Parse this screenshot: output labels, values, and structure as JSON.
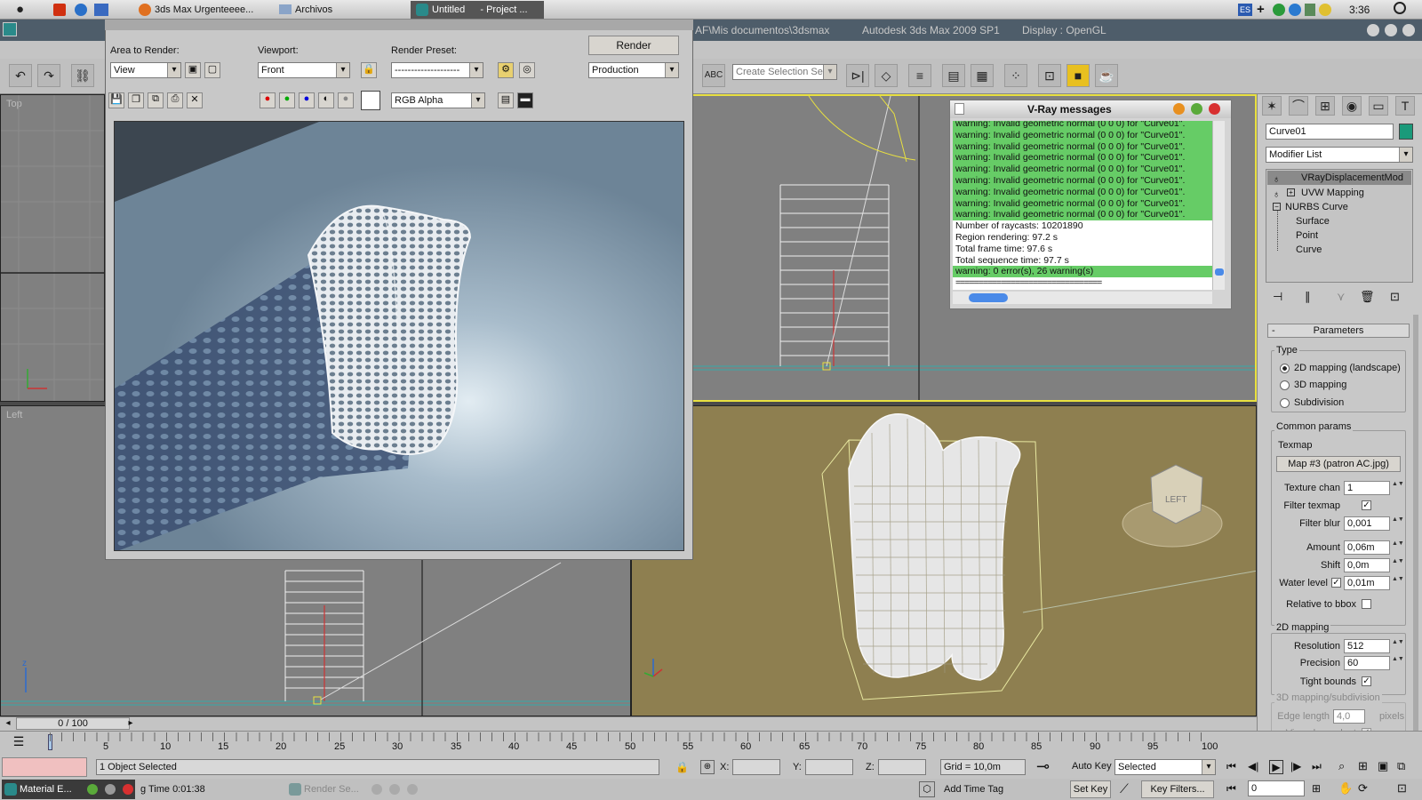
{
  "taskbar_top": {
    "tasks": [
      {
        "label": "3ds Max Urgenteeee..."
      },
      {
        "label": "Archivos"
      },
      {
        "label": "Untitled"
      },
      {
        "label": "- Project ..."
      }
    ],
    "tray_badge": "ES",
    "clock": "3:36"
  },
  "max": {
    "title_path": "AF\\Mis documentos\\3dsmax",
    "title_app": "Autodesk 3ds Max  2009 SP1",
    "title_display": "Display : OpenGL",
    "selection_set_placeholder": "Create Selection Set",
    "viewport_labels": {
      "top": "Top",
      "left": "Left"
    }
  },
  "render_window": {
    "area_label": "Area to Render:",
    "area_value": "View",
    "viewport_label": "Viewport:",
    "viewport_value": "Front",
    "preset_label": "Render Preset:",
    "preset_value": "--------------------",
    "render_button": "Render",
    "production_value": "Production",
    "channel_value": "RGB Alpha"
  },
  "vray": {
    "title": "V-Ray messages",
    "warnings": [
      "warning: Invalid geometric normal (0 0 0) for \"Curve01\".",
      "warning: Invalid geometric normal (0 0 0) for \"Curve01\".",
      "warning: Invalid geometric normal (0 0 0) for \"Curve01\".",
      "warning: Invalid geometric normal (0 0 0) for \"Curve01\".",
      "warning: Invalid geometric normal (0 0 0) for \"Curve01\".",
      "warning: Invalid geometric normal (0 0 0) for \"Curve01\".",
      "warning: Invalid geometric normal (0 0 0) for \"Curve01\".",
      "warning: Invalid geometric normal (0 0 0) for \"Curve01\".",
      "warning: Invalid geometric normal (0 0 0) for \"Curve01\"."
    ],
    "stats": [
      "Number of raycasts: 10201890",
      "Region rendering: 97.2 s",
      "Total frame time: 97.6 s",
      "Total sequence time: 97.7 s"
    ],
    "summary": "warning: 0 error(s), 26 warning(s)",
    "divider": "================================"
  },
  "command_panel": {
    "object_name": "Curve01",
    "object_color": "#1a9a7a",
    "modifier_list": "Modifier List",
    "stack": [
      {
        "label": "VRayDisplacementMod",
        "selected": true
      },
      {
        "label": "UVW Mapping",
        "selected": false
      },
      {
        "label": "NURBS Curve",
        "selected": false
      },
      {
        "label": "Surface",
        "selected": false
      },
      {
        "label": "Point",
        "selected": false
      },
      {
        "label": "Curve",
        "selected": false
      }
    ],
    "params": {
      "rollout": "Parameters",
      "type_group": "Type",
      "type_options": [
        "2D mapping (landscape)",
        "3D mapping",
        "Subdivision"
      ],
      "common_group": "Common params",
      "texmap_label": "Texmap",
      "texmap_button": "Map #3 (patron AC.jpg)",
      "texture_chan_label": "Texture chan",
      "texture_chan_value": "1",
      "filter_texmap_label": "Filter texmap",
      "filter_blur_label": "Filter blur",
      "filter_blur_value": "0,001",
      "amount_label": "Amount",
      "amount_value": "0,06m",
      "shift_label": "Shift",
      "shift_value": "0,0m",
      "water_label": "Water level",
      "water_value": "0,01m",
      "relative_label": "Relative to bbox",
      "mapping2d_group": "2D mapping",
      "resolution_label": "Resolution",
      "resolution_value": "512",
      "precision_label": "Precision",
      "precision_value": "60",
      "tight_label": "Tight bounds",
      "mapping3d_group": "3D mapping/subdivision",
      "edge_label": "Edge length",
      "edge_value": "4,0",
      "edge_unit": "pixels",
      "view_dep_label": "View-dependent"
    }
  },
  "timeline": {
    "frame_counter": "0 / 100",
    "ticks": [
      "5",
      "10",
      "15",
      "20",
      "25",
      "30",
      "35",
      "40",
      "45",
      "50",
      "55",
      "60",
      "65",
      "70",
      "75",
      "80",
      "85",
      "90",
      "95",
      "100"
    ]
  },
  "status": {
    "objects_selected": "1 Object Selected",
    "x_label": "X:",
    "y_label": "Y:",
    "z_label": "Z:",
    "grid": "Grid = 10,0m",
    "auto_key": "Auto Key",
    "set_key": "Set Key",
    "selected_value": "Selected",
    "key_filters": "Key Filters...",
    "add_time_tag": "Add Time Tag",
    "frame_value": "0",
    "render_time": "g Time  0:01:38"
  },
  "taskbar_bottom": {
    "material_editor": "Material E...",
    "render_setup": "Render Se..."
  }
}
